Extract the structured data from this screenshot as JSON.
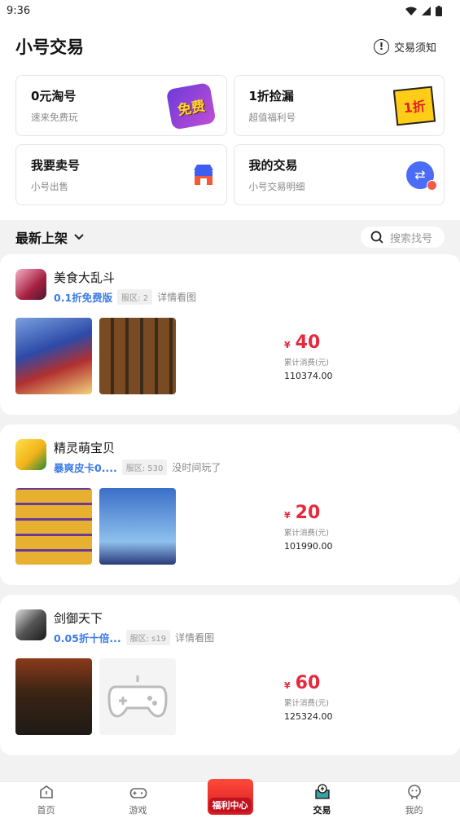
{
  "status": {
    "time": "9:36"
  },
  "header": {
    "title": "小号交易",
    "notice_label": "交易须知"
  },
  "cards": [
    {
      "title": "0元淘号",
      "subtitle": "速来免费玩",
      "badge": "免费"
    },
    {
      "title": "1折捡漏",
      "subtitle": "超值福利号",
      "badge": "1折"
    },
    {
      "title": "我要卖号",
      "subtitle": "小号出售"
    },
    {
      "title": "我的交易",
      "subtitle": "小号交易明细"
    }
  ],
  "filter": {
    "label": "最新上架",
    "search_placeholder": "搜索找号"
  },
  "listings": [
    {
      "title": "美食大乱斗",
      "promo": "0.1折免费版",
      "server": "服区: 2",
      "desc": "详情看图",
      "currency": "¥",
      "price": "40",
      "cum_label": "累计消费(元)",
      "cum_value": "110374.00"
    },
    {
      "title": "精灵萌宝贝",
      "promo": "暴爽皮卡0....",
      "server": "服区: 530",
      "desc": "没时间玩了",
      "currency": "¥",
      "price": "20",
      "cum_label": "累计消费(元)",
      "cum_value": "101990.00"
    },
    {
      "title": "剑御天下",
      "promo": "0.05折十倍...",
      "server": "服区: s19",
      "desc": "详情看图",
      "currency": "¥",
      "price": "60",
      "cum_label": "累计消费(元)",
      "cum_value": "125324.00"
    }
  ],
  "tabs": [
    {
      "label": "首页",
      "icon": "home-icon"
    },
    {
      "label": "游戏",
      "icon": "gamepad-icon"
    },
    {
      "label": "福利中心",
      "icon": "gift-icon"
    },
    {
      "label": "交易",
      "icon": "trade-icon"
    },
    {
      "label": "我的",
      "icon": "user-icon"
    }
  ],
  "colors": {
    "accent": "#3c7be8",
    "price": "#e6293c",
    "swap_icon": "#4a6cf7"
  }
}
